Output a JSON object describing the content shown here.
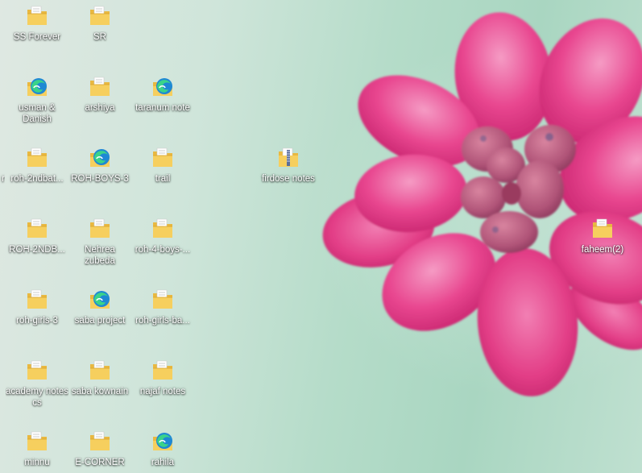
{
  "desktop": {
    "icons": [
      {
        "label": "SS Forever",
        "type": "folder"
      },
      {
        "label": "SR",
        "type": "folder"
      },
      {
        "label": "usman & Danish",
        "type": "edge"
      },
      {
        "label": "arshiya",
        "type": "folder"
      },
      {
        "label": "taranum note",
        "type": "edge"
      },
      {
        "label": "r",
        "type": "folder"
      },
      {
        "label": "roh-2ndbat...",
        "type": "folder"
      },
      {
        "label": "ROH-BOYS-3",
        "type": "edge"
      },
      {
        "label": "trail",
        "type": "folder"
      },
      {
        "label": "firdose notes",
        "type": "zip"
      },
      {
        "label": "ROH-2NDB...",
        "type": "folder"
      },
      {
        "label": "Nehrea zubeda",
        "type": "folder"
      },
      {
        "label": "roh-4-boys-...",
        "type": "folder"
      },
      {
        "label": "faheem(2)",
        "type": "folder"
      },
      {
        "label": "roh-girls-3",
        "type": "folder"
      },
      {
        "label": "saba project",
        "type": "edge"
      },
      {
        "label": "roh-girls-ba...",
        "type": "folder"
      },
      {
        "label": "academy notes cs",
        "type": "folder"
      },
      {
        "label": "saba kownain",
        "type": "folder"
      },
      {
        "label": "najaf notes",
        "type": "folder"
      },
      {
        "label": "minnu",
        "type": "folder"
      },
      {
        "label": "E-CORNER",
        "type": "folder"
      },
      {
        "label": "rahila",
        "type": "edge"
      }
    ]
  },
  "wallpaper": {
    "subject": "pink succulent flower on mint green background",
    "colors": {
      "petal": "#e8468f",
      "petal_light": "#f27fb3",
      "center": "#b04c7a",
      "background": "#b5dcc9"
    }
  },
  "icon_names": {
    "folder": "folder-icon",
    "edge": "edge-icon",
    "zip": "zip-folder-icon"
  }
}
